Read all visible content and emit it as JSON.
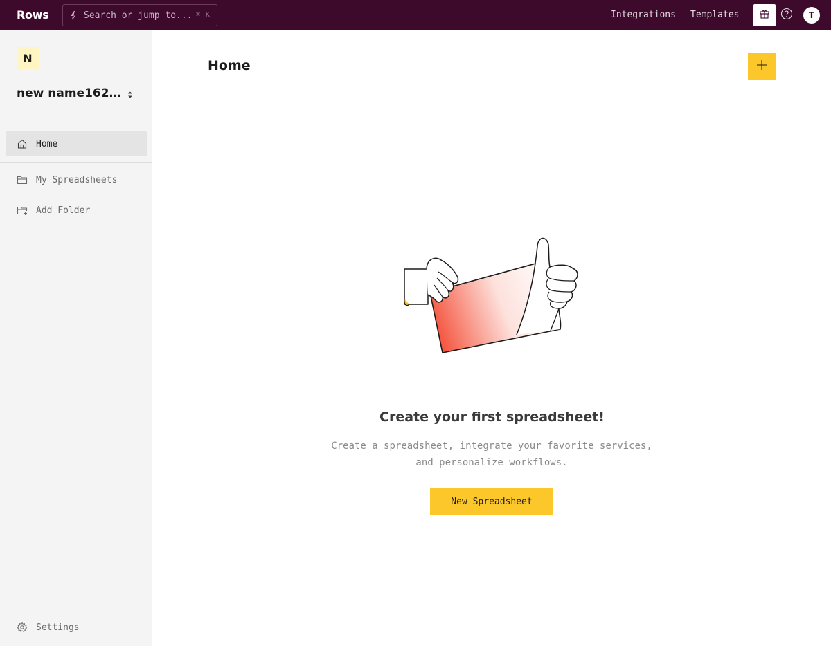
{
  "app": {
    "logo": "Rows"
  },
  "topbar": {
    "search_placeholder": "Search or jump to...",
    "search_shortcut": "⌘ K",
    "links": [
      {
        "label": "Integrations"
      },
      {
        "label": "Templates"
      }
    ],
    "gift_icon": "gift-icon",
    "help_icon": "help-circle-icon",
    "avatar_initial": "T"
  },
  "sidebar": {
    "workspace_initial": "N",
    "workspace_name": "new name1621...",
    "items": [
      {
        "label": "Home",
        "icon": "home-icon",
        "active": true
      },
      {
        "label": "My Spreadsheets",
        "icon": "folder-icon"
      },
      {
        "label": "Add Folder",
        "icon": "folder-plus-icon"
      }
    ],
    "settings_label": "Settings"
  },
  "main": {
    "title": "Home",
    "empty_state": {
      "title": "Create your first spreadsheet!",
      "description": "Create a spreadsheet, integrate your favorite services, and personalize workflows.",
      "button_label": "New Spreadsheet"
    }
  },
  "colors": {
    "topbar_bg": "#3d0a2c",
    "accent_yellow": "#fcc72b",
    "sidebar_bg": "#f4f4f4",
    "active_item_bg": "#e4e4e4",
    "illustration_red": "#f4533d"
  }
}
